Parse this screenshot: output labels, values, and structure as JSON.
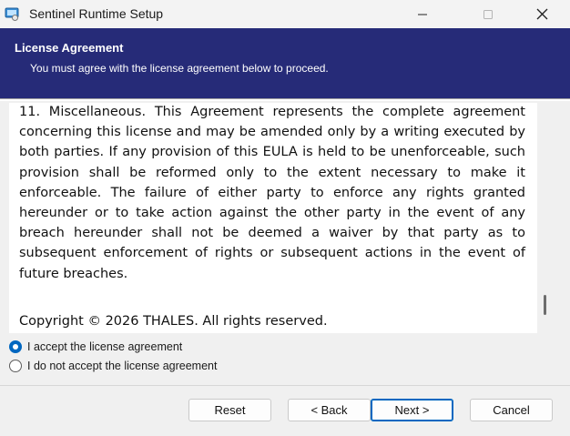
{
  "window": {
    "title": "Sentinel Runtime Setup",
    "controls": {
      "minimize": "minimize-icon",
      "maximize": "maximize-icon",
      "close": "close-icon"
    }
  },
  "banner": {
    "title": "License Agreement",
    "subtitle": "You must agree with the license agreement below to proceed.",
    "background": "#262b78"
  },
  "license": {
    "body": "11. Miscellaneous. This Agreement represents the complete agreement concerning this license and may be amended only by a writing executed by both parties. If any provision of this EULA is held to be unenforceable, such provision shall be reformed only to the extent necessary to make it enforceable. The failure of either party to enforce any rights granted hereunder or to take action against the other party in the event of any breach hereunder shall not be deemed a waiver by that party as to subsequent enforcement of rights or subsequent actions in the event of future breaches.",
    "copyright": "Copyright © 2026 THALES. All rights reserved."
  },
  "options": {
    "accept": {
      "label": "I accept the license agreement",
      "selected": true
    },
    "decline": {
      "label": "I do not accept the license agreement",
      "selected": false
    }
  },
  "buttons": {
    "reset": "Reset",
    "back": "< Back",
    "next": "Next >",
    "cancel": "Cancel"
  },
  "colors": {
    "accent": "#0067c0"
  }
}
